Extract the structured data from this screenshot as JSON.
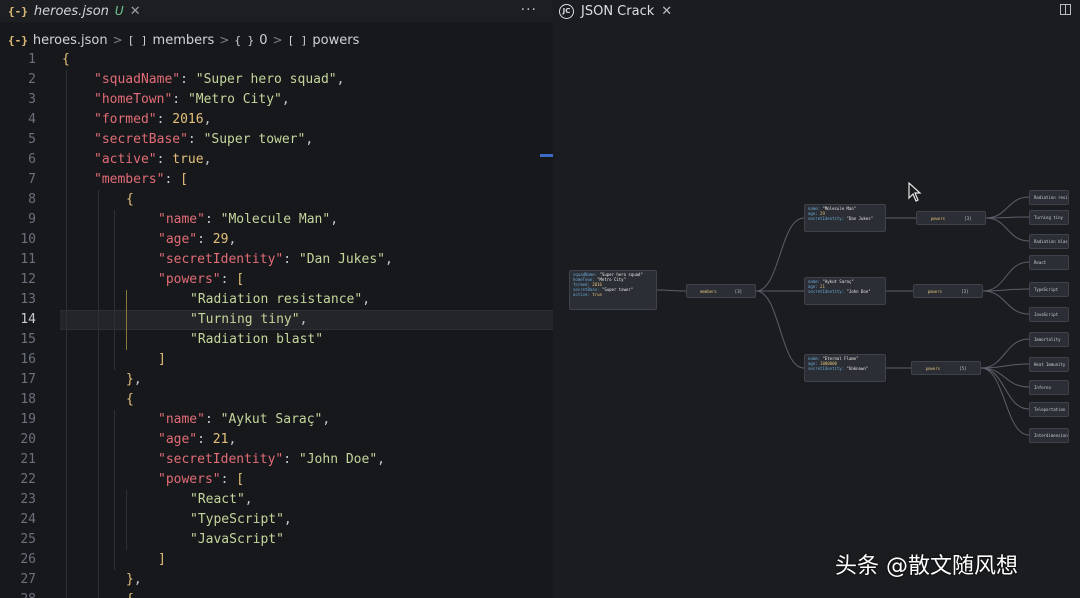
{
  "editor": {
    "tab": {
      "icon": "json-file-icon",
      "icon_glyph": "{-}",
      "filename": "heroes.json",
      "status": "U",
      "close_glyph": "✕"
    },
    "more_actions_glyph": "···",
    "breadcrumb": [
      {
        "icon": "json-file-icon",
        "glyph": "{-}",
        "label": "heroes.json"
      },
      {
        "icon": "array-icon",
        "glyph": "[ ]",
        "label": "members"
      },
      {
        "icon": "object-icon",
        "glyph": "{ }",
        "label": "0"
      },
      {
        "icon": "array-icon",
        "glyph": "[ ]",
        "label": "powers"
      }
    ],
    "current_line": 14,
    "lines": [
      {
        "num": "1",
        "indent": 0,
        "tokens": [
          [
            "b",
            "{"
          ]
        ]
      },
      {
        "num": "2",
        "indent": 1,
        "tokens": [
          [
            "k",
            "\"squadName\""
          ],
          [
            "p",
            ": "
          ],
          [
            "s",
            "\"Super hero squad\""
          ],
          [
            "p",
            ","
          ]
        ]
      },
      {
        "num": "3",
        "indent": 1,
        "tokens": [
          [
            "k",
            "\"homeTown\""
          ],
          [
            "p",
            ": "
          ],
          [
            "s",
            "\"Metro City\""
          ],
          [
            "p",
            ","
          ]
        ]
      },
      {
        "num": "4",
        "indent": 1,
        "tokens": [
          [
            "k",
            "\"formed\""
          ],
          [
            "p",
            ": "
          ],
          [
            "n",
            "2016"
          ],
          [
            "p",
            ","
          ]
        ]
      },
      {
        "num": "5",
        "indent": 1,
        "tokens": [
          [
            "k",
            "\"secretBase\""
          ],
          [
            "p",
            ": "
          ],
          [
            "s",
            "\"Super tower\""
          ],
          [
            "p",
            ","
          ]
        ]
      },
      {
        "num": "6",
        "indent": 1,
        "tokens": [
          [
            "k",
            "\"active\""
          ],
          [
            "p",
            ": "
          ],
          [
            "n",
            "true"
          ],
          [
            "p",
            ","
          ]
        ]
      },
      {
        "num": "7",
        "indent": 1,
        "tokens": [
          [
            "k",
            "\"members\""
          ],
          [
            "p",
            ": "
          ],
          [
            "b",
            "["
          ]
        ]
      },
      {
        "num": "8",
        "indent": 2,
        "tokens": [
          [
            "b",
            "{"
          ]
        ]
      },
      {
        "num": "9",
        "indent": 3,
        "tokens": [
          [
            "k",
            "\"name\""
          ],
          [
            "p",
            ": "
          ],
          [
            "s",
            "\"Molecule Man\""
          ],
          [
            "p",
            ","
          ]
        ]
      },
      {
        "num": "10",
        "indent": 3,
        "tokens": [
          [
            "k",
            "\"age\""
          ],
          [
            "p",
            ": "
          ],
          [
            "n",
            "29"
          ],
          [
            "p",
            ","
          ]
        ]
      },
      {
        "num": "11",
        "indent": 3,
        "tokens": [
          [
            "k",
            "\"secretIdentity\""
          ],
          [
            "p",
            ": "
          ],
          [
            "s",
            "\"Dan Jukes\""
          ],
          [
            "p",
            ","
          ]
        ]
      },
      {
        "num": "12",
        "indent": 3,
        "tokens": [
          [
            "k",
            "\"powers\""
          ],
          [
            "p",
            ": "
          ],
          [
            "b",
            "["
          ]
        ]
      },
      {
        "num": "13",
        "indent": 4,
        "tokens": [
          [
            "s",
            "\"Radiation resistance\""
          ],
          [
            "p",
            ","
          ]
        ]
      },
      {
        "num": "14",
        "indent": 4,
        "tokens": [
          [
            "s",
            "\"Turning tiny\""
          ],
          [
            "p",
            ","
          ]
        ]
      },
      {
        "num": "15",
        "indent": 4,
        "tokens": [
          [
            "s",
            "\"Radiation blast\""
          ]
        ]
      },
      {
        "num": "16",
        "indent": 3,
        "tokens": [
          [
            "b",
            "]"
          ]
        ]
      },
      {
        "num": "17",
        "indent": 2,
        "tokens": [
          [
            "b",
            "}"
          ],
          [
            "p",
            ","
          ]
        ]
      },
      {
        "num": "18",
        "indent": 2,
        "tokens": [
          [
            "b",
            "{"
          ]
        ]
      },
      {
        "num": "19",
        "indent": 3,
        "tokens": [
          [
            "k",
            "\"name\""
          ],
          [
            "p",
            ": "
          ],
          [
            "s",
            "\"Aykut Saraç\""
          ],
          [
            "p",
            ","
          ]
        ]
      },
      {
        "num": "20",
        "indent": 3,
        "tokens": [
          [
            "k",
            "\"age\""
          ],
          [
            "p",
            ": "
          ],
          [
            "n",
            "21"
          ],
          [
            "p",
            ","
          ]
        ]
      },
      {
        "num": "21",
        "indent": 3,
        "tokens": [
          [
            "k",
            "\"secretIdentity\""
          ],
          [
            "p",
            ": "
          ],
          [
            "s",
            "\"John Doe\""
          ],
          [
            "p",
            ","
          ]
        ]
      },
      {
        "num": "22",
        "indent": 3,
        "tokens": [
          [
            "k",
            "\"powers\""
          ],
          [
            "p",
            ": "
          ],
          [
            "b",
            "["
          ]
        ]
      },
      {
        "num": "23",
        "indent": 4,
        "tokens": [
          [
            "s",
            "\"React\""
          ],
          [
            "p",
            ","
          ]
        ]
      },
      {
        "num": "24",
        "indent": 4,
        "tokens": [
          [
            "s",
            "\"TypeScript\""
          ],
          [
            "p",
            ","
          ]
        ]
      },
      {
        "num": "25",
        "indent": 4,
        "tokens": [
          [
            "s",
            "\"JavaScript\""
          ]
        ]
      },
      {
        "num": "26",
        "indent": 3,
        "tokens": [
          [
            "b",
            "]"
          ]
        ]
      },
      {
        "num": "27",
        "indent": 2,
        "tokens": [
          [
            "b",
            "}"
          ],
          [
            "p",
            ","
          ]
        ]
      },
      {
        "num": "28",
        "indent": 2,
        "tokens": [
          [
            "b",
            "{"
          ]
        ]
      }
    ]
  },
  "viewer": {
    "tab": {
      "logo_text": "JC",
      "title": "JSON Crack",
      "close_glyph": "✕"
    },
    "split_icon": "split-editor-icon",
    "graph": {
      "root": [
        [
          "squadName",
          "\"Super hero squad\""
        ],
        [
          "homeTown",
          "\"Metro City\""
        ],
        [
          "formed",
          "2016"
        ],
        [
          "secretBase",
          "\"Super tower\""
        ],
        [
          "active",
          "true"
        ]
      ],
      "members": {
        "label": "members",
        "count": "[3]"
      },
      "heroes": [
        {
          "fields": [
            [
              "name",
              "\"Molecule Man\""
            ],
            [
              "age",
              "29"
            ],
            [
              "secretIdentity",
              "\"Dan Jukes\""
            ]
          ],
          "powers_label": "powers",
          "powers_count": "[3]",
          "powers": [
            "Radiation resistance",
            "Turning tiny",
            "Radiation blast"
          ]
        },
        {
          "fields": [
            [
              "name",
              "\"Aykut Saraç\""
            ],
            [
              "age",
              "21"
            ],
            [
              "secretIdentity",
              "\"John Doe\""
            ]
          ],
          "powers_label": "powers",
          "powers_count": "[3]",
          "powers": [
            "React",
            "TypeScript",
            "JavaScript"
          ]
        },
        {
          "fields": [
            [
              "name",
              "\"Eternal Flame\""
            ],
            [
              "age",
              "1000000"
            ],
            [
              "secretIdentity",
              "\"Unknown\""
            ]
          ],
          "powers_label": "powers",
          "powers_count": "[5]",
          "powers": [
            "Immortality",
            "Heat Immunity",
            "Inferno",
            "Teleportation",
            "Interdimensional travel"
          ]
        }
      ]
    }
  },
  "watermark": "头条 @散文随风想"
}
